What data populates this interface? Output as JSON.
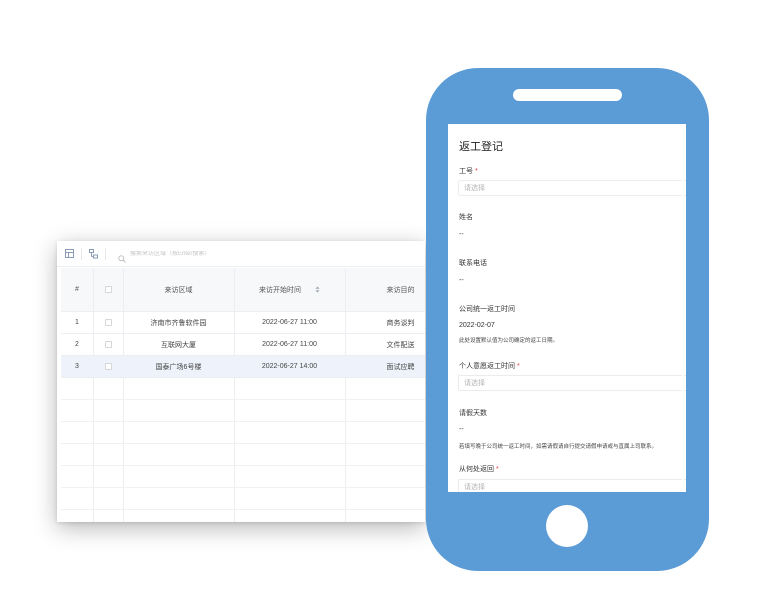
{
  "table": {
    "search_placeholder": "搜索来访区域（按Enter搜索）",
    "columns": {
      "index": "#",
      "area": "来访区域",
      "start_time": "来访开始时间",
      "purpose": "来访目的"
    },
    "rows": [
      {
        "index": "1",
        "area": "济南市齐鲁软件园",
        "start_time": "2022-06-27 11:00",
        "purpose": "商务谈判"
      },
      {
        "index": "2",
        "area": "互联网大厦",
        "start_time": "2022-06-27 11:00",
        "purpose": "文件配送"
      },
      {
        "index": "3",
        "area": "国泰广场6号楼",
        "start_time": "2022-06-27 14:00",
        "purpose": "面试应聘"
      }
    ],
    "colors": {
      "link": "#4a90d9",
      "highlight_row": "#eef3fb"
    }
  },
  "phone": {
    "colors": {
      "body": "#5b9bd6"
    },
    "form": {
      "title": "返工登记",
      "employee_id": {
        "label": "工号",
        "placeholder": "请选择"
      },
      "name": {
        "label": "姓名",
        "value": "--"
      },
      "phone": {
        "label": "联系电话",
        "value": "--"
      },
      "company_date": {
        "label": "公司统一返工时间",
        "value": "2022-02-07",
        "hint": "此处设置默认值为公司确定的返工日期。"
      },
      "personal_date": {
        "label": "个人意愿返工时间",
        "placeholder": "请选择"
      },
      "leave_days": {
        "label": "请假天数",
        "value": "--",
        "hint": "若填写晚于公司统一返工时间，如需请假请自行提交请假申请或与直属上司联系。"
      },
      "return_from": {
        "label": "从何处返回",
        "placeholder": "请选择"
      }
    }
  }
}
